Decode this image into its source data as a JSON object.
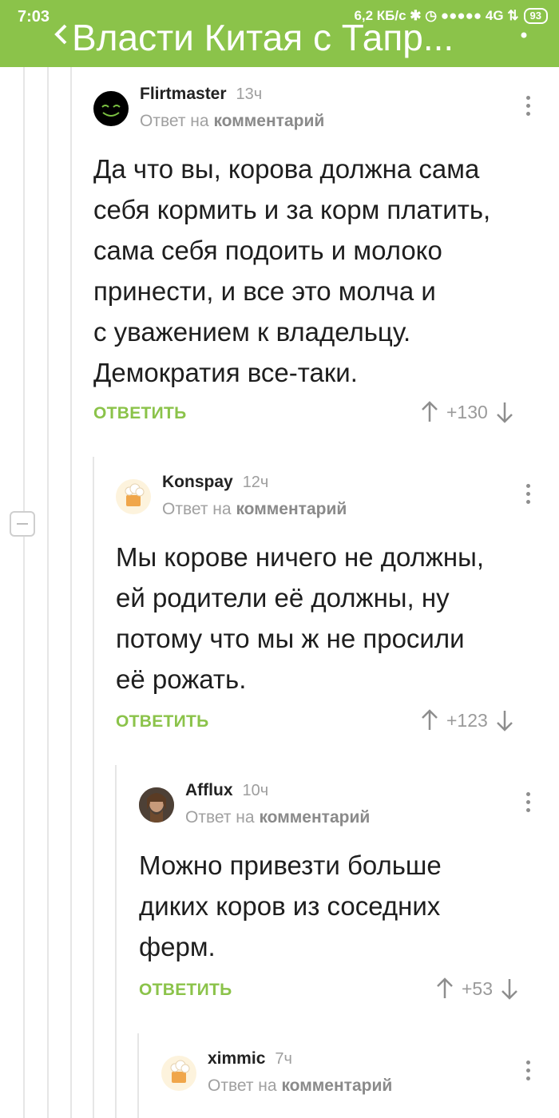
{
  "status_bar": {
    "time": "7:03",
    "right": "6,2 КБ/с ✱ ◷ ●●●●● 4G ⇅",
    "battery": "93"
  },
  "header": {
    "title": "Власти Китая с Тапр..."
  },
  "colors": {
    "accent": "#8bc34a",
    "muted": "#9e9e9e"
  },
  "comments": [
    {
      "author": "Flirtmaster",
      "time": "13ч",
      "reply_prefix": "Ответ на",
      "reply_link": "комментарий",
      "lines": [
        "Да что вы, корова должна сама",
        "себя кормить и за корм платить,",
        "сама себя подоить и молоко",
        "принести, и все это молча и",
        "с уважением к владельцу.",
        "Демократия все-таки."
      ],
      "reply_label": "ОТВЕТИТЬ",
      "rating": "+130",
      "avatar_icon": "smiley-avatar-icon"
    },
    {
      "author": "Konspay",
      "time": "12ч",
      "reply_prefix": "Ответ на",
      "reply_link": "комментарий",
      "lines": [
        "Мы корове ничего не должны,",
        "ей родители её должны, ну",
        "потому что мы ж не просили",
        "её рожать."
      ],
      "reply_label": "ОТВЕТИТЬ",
      "rating": "+123",
      "avatar_icon": "default-avatar-icon"
    },
    {
      "author": "Afflux",
      "time": "10ч",
      "reply_prefix": "Ответ на",
      "reply_link": "комментарий",
      "lines": [
        "Можно привезти больше",
        "диких коров из соседних",
        "ферм."
      ],
      "reply_label": "ОТВЕТИТЬ",
      "rating": "+53",
      "avatar_icon": "photo-avatar-icon"
    },
    {
      "author": "ximmic",
      "time": "7ч",
      "reply_prefix": "Ответ на",
      "reply_link": "комментарий",
      "avatar_icon": "default-avatar-icon"
    }
  ]
}
